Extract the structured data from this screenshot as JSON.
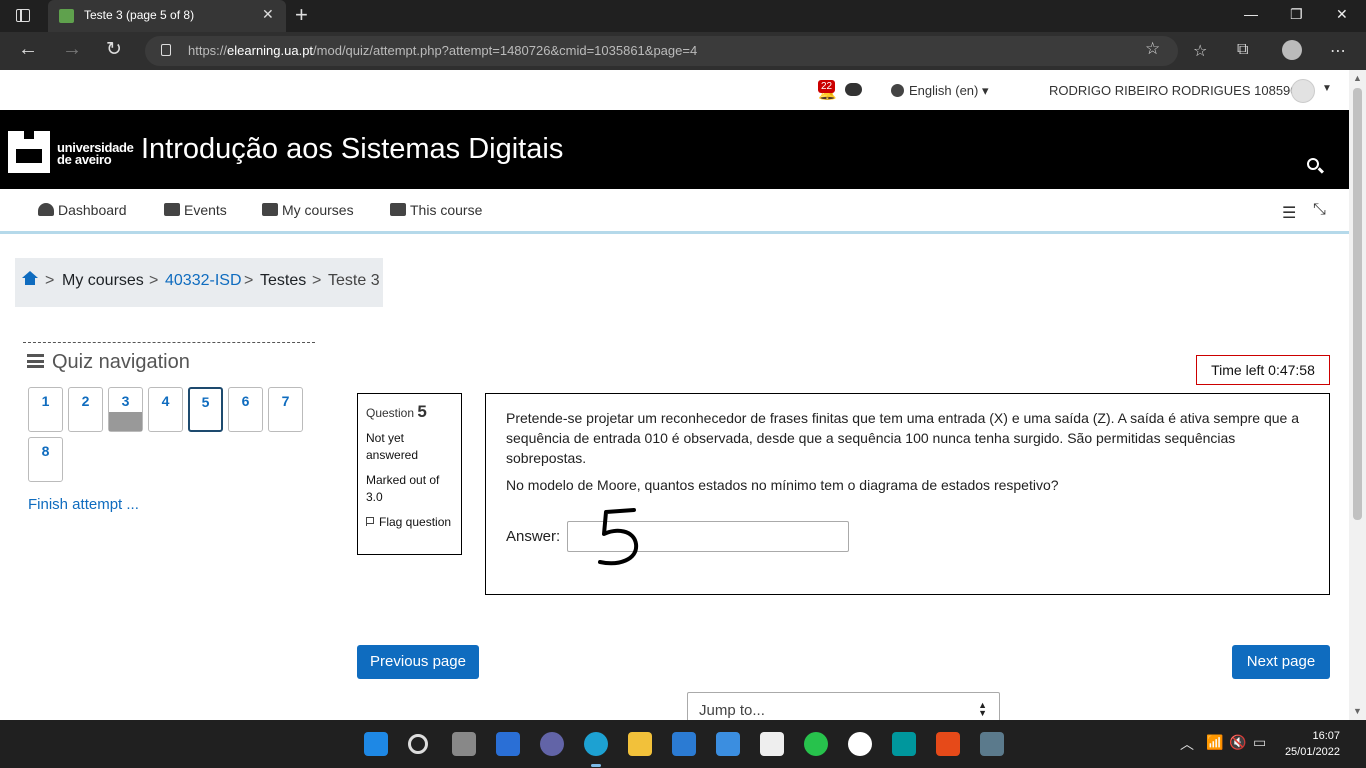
{
  "browser": {
    "tab_title": "Teste 3 (page 5 of 8)",
    "url_prefix": "https://",
    "url_domain": "elearning.ua.pt",
    "url_path": "/mod/quiz/attempt.php?attempt=1480726&cmid=1035861&page=4"
  },
  "topnav": {
    "notifications_count": "22",
    "language": "English (en)",
    "user_name": "RODRIGO RIBEIRO RODRIGUES 108590"
  },
  "banner": {
    "logo_line1": "universidade",
    "logo_line2": "de aveiro",
    "course_title": "Introdução aos Sistemas Digitais"
  },
  "menu": {
    "dashboard": "Dashboard",
    "events": "Events",
    "my_courses": "My courses",
    "this_course": "This course"
  },
  "breadcrumb": {
    "sep": ">",
    "my_courses": "My courses",
    "course": "40332-ISD",
    "section": "Testes",
    "current": "Teste 3"
  },
  "quiz_nav": {
    "title": "Quiz navigation",
    "questions": [
      {
        "label": "1",
        "state": "not-answered"
      },
      {
        "label": "2",
        "state": "not-answered"
      },
      {
        "label": "3",
        "state": "answered"
      },
      {
        "label": "4",
        "state": "not-answered"
      },
      {
        "label": "5",
        "state": "current"
      },
      {
        "label": "6",
        "state": "not-answered"
      },
      {
        "label": "7",
        "state": "not-answered"
      },
      {
        "label": "8",
        "state": "not-answered"
      }
    ],
    "finish_link": "Finish attempt ..."
  },
  "timer": {
    "label": "Time left 0:47:58"
  },
  "question_info": {
    "label": "Question",
    "number": "5",
    "status": "Not yet answered",
    "marks": "Marked out of 3.0",
    "flag": "Flag question"
  },
  "question": {
    "text1": "Pretende-se projetar um reconhecedor de frases finitas que tem uma entrada (X) e uma saída (Z). A saída é ativa sempre que a sequência de entrada 010 é observada, desde que a sequência 100 nunca tenha surgido.  São permitidas sequências sobrepostas.",
    "text2": "No modelo de Moore, quantos estados no mínimo tem o diagrama de estados respetivo?",
    "answer_label": "Answer:",
    "answer_value": "",
    "handwritten_note": "5"
  },
  "buttons": {
    "previous": "Previous page",
    "next": "Next page",
    "jump_to": "Jump to..."
  },
  "taskbar": {
    "time": "16:07",
    "date": "25/01/2022"
  }
}
